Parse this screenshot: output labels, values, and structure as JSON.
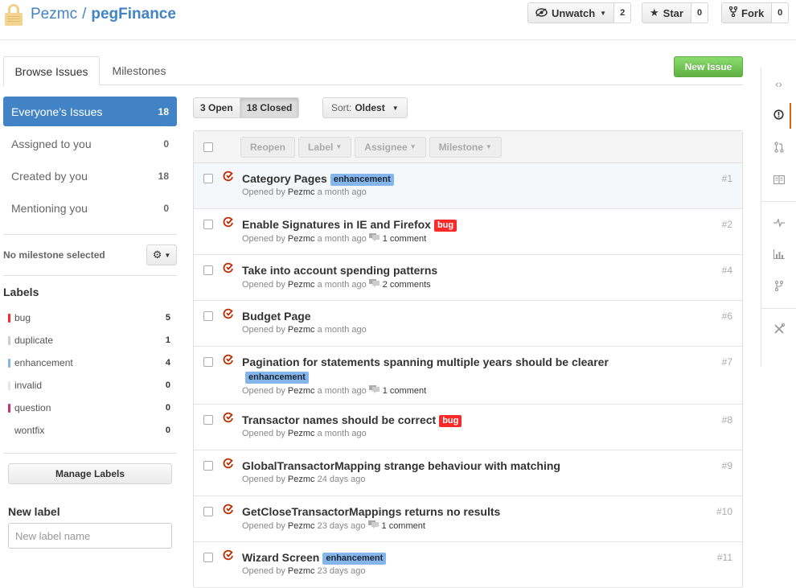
{
  "repo": {
    "owner": "Pezmc",
    "slash": "/",
    "name": "pegFinance"
  },
  "header_buttons": {
    "unwatch": {
      "label": "Unwatch",
      "count": "2"
    },
    "star": {
      "label": "Star",
      "count": "0"
    },
    "fork": {
      "label": "Fork",
      "count": "0"
    }
  },
  "tabs": {
    "browse": "Browse Issues",
    "milestones": "Milestones"
  },
  "new_issue_label": "New Issue",
  "filters": [
    {
      "label": "Everyone’s Issues",
      "count": "18"
    },
    {
      "label": "Assigned to you",
      "count": "0"
    },
    {
      "label": "Created by you",
      "count": "18"
    },
    {
      "label": "Mentioning you",
      "count": "0"
    }
  ],
  "milestone": {
    "text": "No milestone selected"
  },
  "labels_heading": "Labels",
  "labels": [
    {
      "name": "bug",
      "count": "5",
      "color": "#fc2929"
    },
    {
      "name": "duplicate",
      "count": "1",
      "color": "#cccccc"
    },
    {
      "name": "enhancement",
      "count": "4",
      "color": "#84b6eb"
    },
    {
      "name": "invalid",
      "count": "0",
      "color": "#e6e6e6"
    },
    {
      "name": "question",
      "count": "0",
      "color": "#cc317c"
    },
    {
      "name": "wontfix",
      "count": "0",
      "color": "#ffffff"
    }
  ],
  "manage_labels": "Manage Labels",
  "new_label": {
    "heading": "New label",
    "placeholder": "New label name"
  },
  "state": {
    "open": "3 Open",
    "closed": "18 Closed"
  },
  "sort": {
    "label": "Sort:",
    "value": "Oldest"
  },
  "bulk": {
    "reopen": "Reopen",
    "label": "Label",
    "assignee": "Assignee",
    "milestone": "Milestone"
  },
  "issues": [
    {
      "title": "Category Pages",
      "tag": "enhancement",
      "author": "Pezmc",
      "prefix": "Opened by",
      "time": "a month ago",
      "comments": "",
      "number": "#1"
    },
    {
      "title": "Enable Signatures in IE and Firefox",
      "tag": "bug",
      "author": "Pezmc",
      "prefix": "Opened by",
      "time": "a month ago",
      "comments": "1 comment",
      "number": "#2"
    },
    {
      "title": "Take into account spending patterns",
      "tag": "",
      "author": "Pezmc",
      "prefix": "Opened by",
      "time": "a month ago",
      "comments": "2 comments",
      "number": "#4"
    },
    {
      "title": "Budget Page",
      "tag": "",
      "author": "Pezmc",
      "prefix": "Opened by",
      "time": "a month ago",
      "comments": "",
      "number": "#6"
    },
    {
      "title": "Pagination for statements spanning multiple years should be clearer",
      "tag": "enhancement",
      "author": "Pezmc",
      "prefix": "Opened by",
      "time": "a month ago",
      "comments": "1 comment",
      "number": "#7"
    },
    {
      "title": "Transactor names should be correct",
      "tag": "bug",
      "author": "Pezmc",
      "prefix": "Opened by",
      "time": "a month ago",
      "comments": "",
      "number": "#8"
    },
    {
      "title": "GlobalTransactorMapping strange behaviour with matching",
      "tag": "",
      "author": "Pezmc",
      "prefix": "Opened by",
      "time": "24 days ago",
      "comments": "",
      "number": "#9"
    },
    {
      "title": "GetCloseTransactorMappings returns no results",
      "tag": "",
      "author": "Pezmc",
      "prefix": "Opened by",
      "time": "23 days ago",
      "comments": "1 comment",
      "number": "#10"
    },
    {
      "title": "Wizard Screen",
      "tag": "enhancement",
      "author": "Pezmc",
      "prefix": "Opened by",
      "time": "23 days ago",
      "comments": "",
      "number": "#11"
    }
  ],
  "rail_icons": [
    "code-icon",
    "issues-icon",
    "pull-request-icon",
    "wiki-icon",
    "pulse-icon",
    "graphs-icon",
    "network-icon",
    "settings-icon"
  ]
}
